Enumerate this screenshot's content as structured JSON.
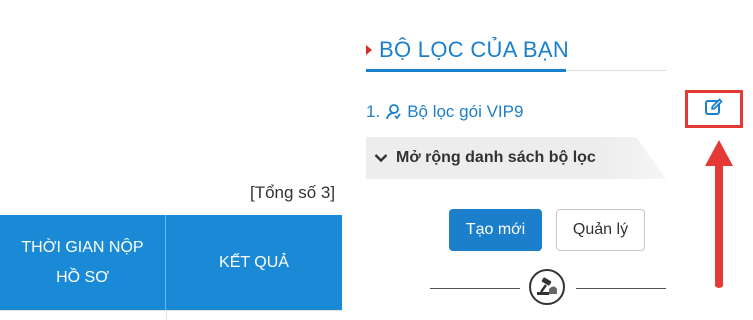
{
  "results": {
    "total_count": "[Tổng số 3]",
    "columns": [
      "THỜI GIAN NỘP HỒ SƠ",
      "KẾT QUẢ"
    ]
  },
  "filter_panel": {
    "title": "BỘ LỌC CỦA BẠN",
    "filters": [
      {
        "index": "1.",
        "name": "Bộ lọc gói VIP9",
        "icon": "user-icon",
        "action_icon": "edit-icon"
      }
    ],
    "expand_label": "Mở rộng danh sách bộ lọc",
    "expand_icon": "chevron-down-icon",
    "create_button": "Tạo mới",
    "manage_button": "Quản lý",
    "divider_icon": "gavel-icon"
  },
  "colors": {
    "accent": "#1b7fcc",
    "header_bg": "#1b8ad6",
    "highlight": "#e53935"
  }
}
